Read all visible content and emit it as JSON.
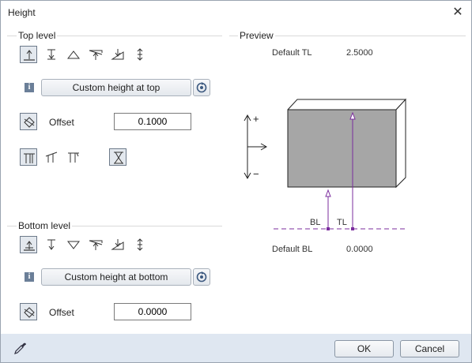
{
  "window": {
    "title": "Height",
    "close_glyph": "✕"
  },
  "top_level": {
    "group_label": "Top level",
    "icons": [
      "top-flush-icon",
      "top-down-arrow-icon",
      "top-triangle-icon",
      "top-slope-icon",
      "top-angled-plane-icon",
      "top-up-down-icon"
    ],
    "info_glyph": "i",
    "custom_height_label": "Custom height at top",
    "offset_label": "Offset",
    "offset_value": "0.1000",
    "extra_icons": [
      "column-flat-icon",
      "column-sloped-left-icon",
      "column-sloped-right-icon"
    ],
    "hourglass_icon": "hourglass-icon"
  },
  "bottom_level": {
    "group_label": "Bottom level",
    "icons": [
      "bottom-flush-icon",
      "bottom-down-arrow-icon",
      "bottom-triangle-icon",
      "bottom-slope-icon",
      "bottom-angled-plane-icon",
      "bottom-up-down-icon"
    ],
    "info_glyph": "i",
    "custom_height_label": "Custom height at bottom",
    "offset_label": "Offset",
    "offset_value": "0.0000"
  },
  "preview": {
    "group_label": "Preview",
    "default_tl_label": "Default TL",
    "default_tl_value": "2.5000",
    "default_bl_label": "Default BL",
    "default_bl_value": "0.0000",
    "plus": "+",
    "minus": "−",
    "bl_tag": "BL",
    "tl_tag": "TL",
    "block_fill": "#a6a6a6",
    "guide_color": "#7b2c9e"
  },
  "footer": {
    "eyedropper_icon": "eyedropper-icon",
    "ok_label": "OK",
    "cancel_label": "Cancel"
  }
}
